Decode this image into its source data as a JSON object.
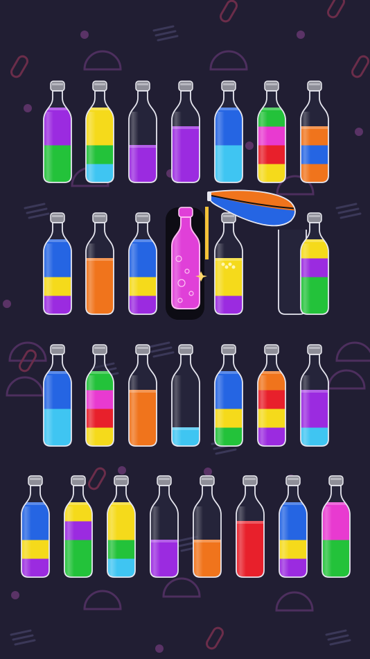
{
  "game": {
    "palette": {
      "purple": "#9b2be0",
      "green": "#23c23a",
      "yellow": "#f5da1b",
      "cyan": "#3fc5f2",
      "blue": "#2565e3",
      "pink": "#e83ad0",
      "red": "#e8202b",
      "orange": "#f0741c"
    },
    "background_color": "#211e33",
    "bottle_capacity": 4,
    "poured_color": "#f5c238",
    "selected_liquid_color": "#e040d8",
    "rows": [
      {
        "bottles": [
          [
            "green",
            "green",
            "purple",
            "purple"
          ],
          [
            "cyan",
            "green",
            "yellow",
            "yellow"
          ],
          [
            "purple",
            "purple"
          ],
          [
            "purple",
            "purple",
            "purple"
          ],
          [
            "cyan",
            "cyan",
            "blue",
            "blue"
          ],
          [
            "yellow",
            "red",
            "pink",
            "green"
          ],
          [
            "orange",
            "blue",
            "orange"
          ]
        ]
      },
      {
        "bottles": [
          [
            "purple",
            "yellow",
            "blue",
            "blue"
          ],
          [
            "orange",
            "orange",
            "orange"
          ],
          [
            "purple",
            "yellow",
            "blue",
            "blue"
          ],
          {
            "state": "selected"
          },
          {
            "state": "receiving",
            "layers": [
              "purple",
              "yellow",
              "yellow"
            ]
          },
          {
            "state": "pouring",
            "layers": [
              "orange",
              "blue"
            ]
          },
          [
            "green",
            "green",
            "purple",
            "yellow"
          ]
        ]
      },
      {
        "bottles": [
          [
            "cyan",
            "cyan",
            "blue",
            "blue"
          ],
          [
            "yellow",
            "red",
            "pink",
            "green"
          ],
          [
            "orange",
            "orange",
            "orange"
          ],
          [
            "cyan"
          ],
          [
            "green",
            "yellow",
            "blue",
            "blue"
          ],
          [
            "purple",
            "yellow",
            "red",
            "orange"
          ],
          [
            "cyan",
            "purple",
            "purple"
          ]
        ]
      },
      {
        "bottles": [
          [
            "purple",
            "yellow",
            "blue",
            "blue"
          ],
          [
            "green",
            "green",
            "purple",
            "yellow"
          ],
          [
            "cyan",
            "green",
            "yellow",
            "yellow"
          ],
          [
            "purple",
            "purple"
          ],
          [
            "orange",
            "orange"
          ],
          [
            "red",
            "red",
            "red"
          ],
          [
            "purple",
            "yellow",
            "blue",
            "blue"
          ],
          [
            "green",
            "green",
            "pink",
            "pink"
          ]
        ]
      }
    ],
    "decorations": [
      {
        "shape": "half-circle",
        "color": "#4d2f5e"
      },
      {
        "shape": "dot",
        "color": "#5a3366"
      },
      {
        "shape": "stripes",
        "color": "#3b3858"
      },
      {
        "shape": "pill",
        "color": "#6b2d4a"
      }
    ]
  }
}
